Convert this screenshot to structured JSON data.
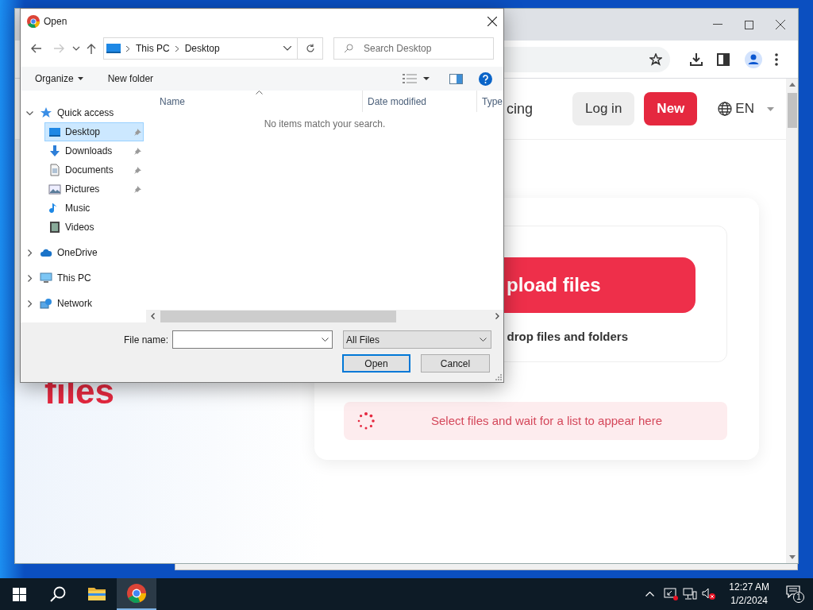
{
  "browser_window": {
    "page": {
      "nav": {
        "partial_link": "cing",
        "login_button": "Log in",
        "new_button": "New",
        "language": "EN"
      },
      "hero_text": "files",
      "upload_card": {
        "upload_button": "pload files",
        "drop_hint": "drop files and folders",
        "status_message": "Select files and wait for a list to appear here"
      }
    }
  },
  "open_dialog": {
    "title": "Open",
    "nav_buttons": [
      {
        "kind": "back",
        "disabled": false
      },
      {
        "kind": "forward",
        "disabled": true
      },
      {
        "kind": "recent",
        "disabled": false
      },
      {
        "kind": "up",
        "disabled": false
      }
    ],
    "breadcrumb": [
      "This PC",
      "Desktop"
    ],
    "search": {
      "placeholder": "Search Desktop"
    },
    "toolbar": {
      "organize": "Organize",
      "new_folder": "New folder"
    },
    "nav_tree": [
      {
        "label": "Quick access",
        "kind": "star",
        "expanded": true,
        "selected": false,
        "children": [
          {
            "label": "Desktop",
            "kind": "desktop",
            "selected": true,
            "pinned": true
          },
          {
            "label": "Downloads",
            "kind": "downloads",
            "selected": false,
            "pinned": true
          },
          {
            "label": "Documents",
            "kind": "documents",
            "selected": false,
            "pinned": true
          },
          {
            "label": "Pictures",
            "kind": "pictures",
            "selected": false,
            "pinned": true
          },
          {
            "label": "Music",
            "kind": "music",
            "selected": false,
            "pinned": false
          },
          {
            "label": "Videos",
            "kind": "videos",
            "selected": false,
            "pinned": false
          }
        ]
      },
      {
        "label": "OneDrive",
        "kind": "cloud",
        "expanded": false,
        "selected": false
      },
      {
        "label": "This PC",
        "kind": "pc",
        "expanded": false,
        "selected": false
      },
      {
        "label": "Network",
        "kind": "network",
        "expanded": false,
        "selected": false
      }
    ],
    "columns": [
      "Name",
      "Date modified",
      "Type"
    ],
    "empty_message": "No items match your search.",
    "file_name": {
      "label": "File name:"
    },
    "file_type": "All Files",
    "buttons": [
      {
        "label": "Open",
        "default": true
      },
      {
        "label": "Cancel",
        "default": false
      }
    ]
  },
  "taskbar": {
    "apps": [
      {
        "kind": "explorer",
        "active": false
      },
      {
        "kind": "chrome",
        "active": true
      }
    ],
    "clock": {
      "time": "12:27 AM",
      "date": "1/2/2024"
    },
    "notification_count": "1"
  }
}
